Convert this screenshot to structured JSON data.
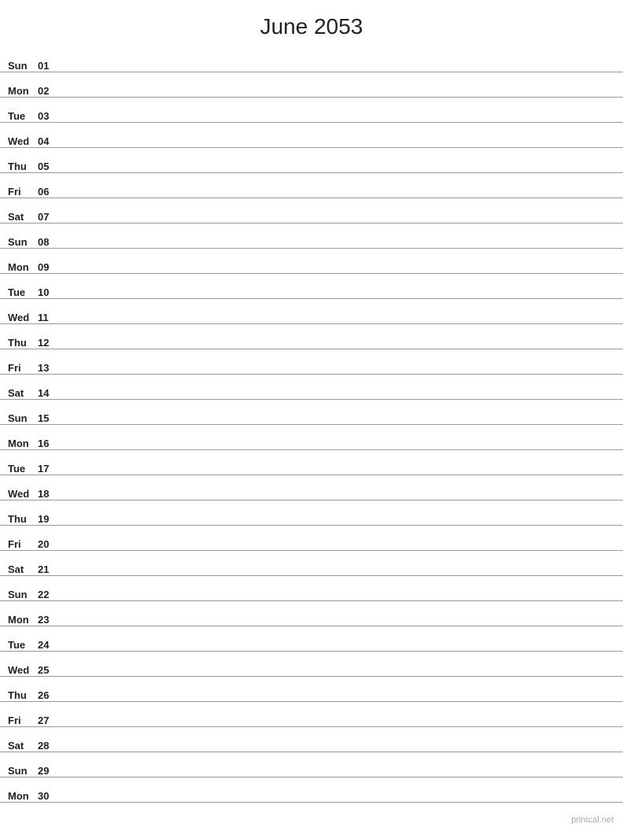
{
  "header": {
    "title": "June 2053"
  },
  "days": [
    {
      "day": "Sun",
      "date": "01"
    },
    {
      "day": "Mon",
      "date": "02"
    },
    {
      "day": "Tue",
      "date": "03"
    },
    {
      "day": "Wed",
      "date": "04"
    },
    {
      "day": "Thu",
      "date": "05"
    },
    {
      "day": "Fri",
      "date": "06"
    },
    {
      "day": "Sat",
      "date": "07"
    },
    {
      "day": "Sun",
      "date": "08"
    },
    {
      "day": "Mon",
      "date": "09"
    },
    {
      "day": "Tue",
      "date": "10"
    },
    {
      "day": "Wed",
      "date": "11"
    },
    {
      "day": "Thu",
      "date": "12"
    },
    {
      "day": "Fri",
      "date": "13"
    },
    {
      "day": "Sat",
      "date": "14"
    },
    {
      "day": "Sun",
      "date": "15"
    },
    {
      "day": "Mon",
      "date": "16"
    },
    {
      "day": "Tue",
      "date": "17"
    },
    {
      "day": "Wed",
      "date": "18"
    },
    {
      "day": "Thu",
      "date": "19"
    },
    {
      "day": "Fri",
      "date": "20"
    },
    {
      "day": "Sat",
      "date": "21"
    },
    {
      "day": "Sun",
      "date": "22"
    },
    {
      "day": "Mon",
      "date": "23"
    },
    {
      "day": "Tue",
      "date": "24"
    },
    {
      "day": "Wed",
      "date": "25"
    },
    {
      "day": "Thu",
      "date": "26"
    },
    {
      "day": "Fri",
      "date": "27"
    },
    {
      "day": "Sat",
      "date": "28"
    },
    {
      "day": "Sun",
      "date": "29"
    },
    {
      "day": "Mon",
      "date": "30"
    }
  ],
  "watermark": "printcal.net"
}
